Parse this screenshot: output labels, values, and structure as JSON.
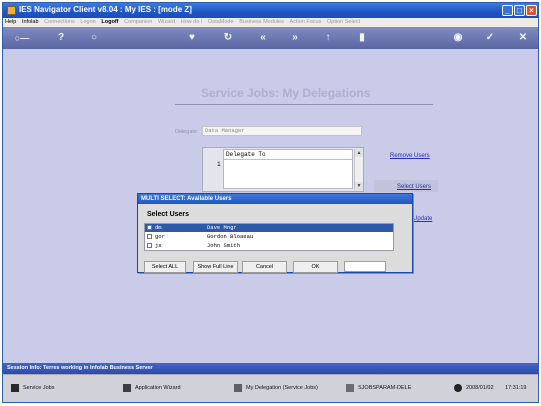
{
  "window": {
    "title": "IES Navigator Client v8.04 : My IES :   [mode Z]",
    "controls": [
      "minimize-icon",
      "maximize-icon",
      "close-icon"
    ]
  },
  "menubar": [
    {
      "label": "Help",
      "style": "normal"
    },
    {
      "label": "Infolab",
      "style": "normal"
    },
    {
      "label": "Connections",
      "style": "dim"
    },
    {
      "label": "Logon",
      "style": "dim"
    },
    {
      "label": "Logoff",
      "style": "bold"
    },
    {
      "label": "Companion",
      "style": "dim"
    },
    {
      "label": "Wizard",
      "style": "dim"
    },
    {
      "label": "How do I",
      "style": "dim"
    },
    {
      "label": "DataMode",
      "style": "dim"
    },
    {
      "label": "Business Modules",
      "style": "dim"
    },
    {
      "label": "Action Focus",
      "style": "dim"
    },
    {
      "label": "Option Select",
      "style": "dim"
    }
  ],
  "toolbar": {
    "icons": [
      "key-icon",
      "help-icon",
      "search-icon",
      "heart-icon",
      "refresh-icon",
      "back-icon",
      "forward-icon",
      "upload-icon",
      "doc-icon",
      "save-icon",
      "check-icon",
      "cancel-icon"
    ],
    "glyphs": {
      "key": "○—",
      "help": "?",
      "search": "○",
      "heart": "♥",
      "refresh": "↻",
      "back": "«",
      "forward": "»",
      "upload": "↑",
      "doc": "▮",
      "save": "◉",
      "check": "✓",
      "cancel": "✕"
    }
  },
  "page": {
    "title": "Service Jobs: My Delegations",
    "delegate_field": {
      "label": "Delegate",
      "value": "Data Manager"
    },
    "grid": {
      "column": "Delegate To",
      "rows": [
        "1"
      ]
    },
    "links": {
      "remove_users": "Remove Users",
      "select_users": "Select Users",
      "update": "Update"
    }
  },
  "dialog": {
    "title": "MULTI SELECT: Available Users",
    "heading": "Select Users",
    "items": [
      {
        "code": "dm",
        "name": "Dave Mngr",
        "selected": true
      },
      {
        "code": "gor",
        "name": "Gordon Bloaeau",
        "selected": false
      },
      {
        "code": "js",
        "name": "John Smith",
        "selected": false
      }
    ],
    "buttons": {
      "select_all": "Select ALL",
      "show_full_line": "Show Full Line",
      "cancel": "Cancel",
      "ok": "OK"
    }
  },
  "statusbar": {
    "text": "Session Info: Terres working in Infolab Business Server"
  },
  "taskbar": {
    "service_jobs": "Service Jobs",
    "app_wizard": "Application Wizard",
    "my_delegation": "My Delegation (Service Jobs)",
    "param": "SJOBSPARAM-DELE",
    "date": "2008/01/02",
    "time": "17:31:19"
  },
  "colors": {
    "titlebar": "#2057c2",
    "background": "#c9cbe8",
    "link": "#2431b8",
    "selection": "#2e58a9"
  }
}
